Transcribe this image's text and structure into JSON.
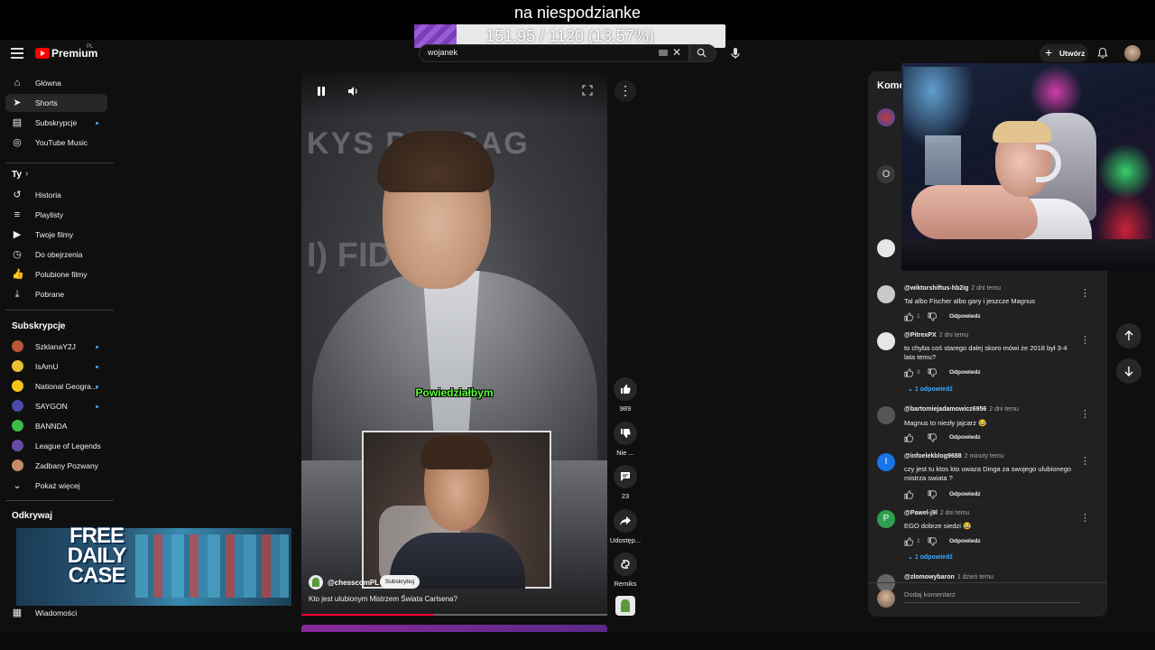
{
  "overlay": {
    "title": "na niespodzianke",
    "progress_text": "151.95 / 1120 (13.57%)",
    "progress_fraction": 0.1357
  },
  "header": {
    "logo_text": "Premium",
    "logo_sup": "PL",
    "search_value": "wojanek",
    "create_label": "Utwórz"
  },
  "sidebar": {
    "main": [
      {
        "label": "Główna",
        "icon": "home-icon"
      },
      {
        "label": "Shorts",
        "icon": "shorts-icon",
        "active": true
      },
      {
        "label": "Subskrypcje",
        "icon": "subscriptions-icon",
        "dot": true
      },
      {
        "label": "YouTube Music",
        "icon": "music-icon"
      }
    ],
    "you_heading": "Ty",
    "you": [
      {
        "label": "Historia",
        "icon": "history-icon"
      },
      {
        "label": "Playlisty",
        "icon": "playlist-icon"
      },
      {
        "label": "Twoje filmy",
        "icon": "your-videos-icon"
      },
      {
        "label": "Do obejrzenia",
        "icon": "watch-later-icon"
      },
      {
        "label": "Polubione filmy",
        "icon": "liked-icon"
      },
      {
        "label": "Pobrane",
        "icon": "download-icon"
      }
    ],
    "subs_heading": "Subskrypcje",
    "subs": [
      {
        "label": "SzklanaY2J",
        "color": "#b8573a"
      },
      {
        "label": "IsAmU",
        "color": "#e8c230"
      },
      {
        "label": "National Geogra...",
        "color": "#f5c518"
      },
      {
        "label": "SAYGON",
        "color": "#4a4aa8"
      },
      {
        "label": "BANNDA",
        "color": "#3dbb4a"
      },
      {
        "label": "League of Legends",
        "color": "#6a4aa8"
      },
      {
        "label": "Zadbany Pozwany",
        "color": "#c48a6a"
      }
    ],
    "show_more": "Pokaż więcej",
    "explore_heading": "Odkrywaj",
    "news": "Wiadomości"
  },
  "ad": {
    "text": "FREE DAILY CASE"
  },
  "video": {
    "backdrop_text": "KYS  PHOSAG",
    "backdrop_text2": "I)  FID    Wor",
    "caption": "Powiedziałbym",
    "channel": "@chesscomPL",
    "subscribe": "Subskrybuj",
    "title": "Kto jest ulubionym Mistrzem Świata Carlsena?",
    "progress_fraction": 0.43,
    "likes": "989",
    "dislike_label": "Nie ...",
    "comments_count": "23",
    "share_label": "Udostęp...",
    "remix_label": "Remiks"
  },
  "comments": {
    "title": "Komentarze",
    "add_placeholder": "Dodaj komentarz",
    "reply_label": "Odpowiedz",
    "items": [
      {
        "author": "@wiktorshiftus-hb2ig",
        "time": "2 dni temu",
        "text": "Tal albo Fischer albo gary i jeszcze Magnus",
        "likes": "1",
        "avatar_color": "#c9c9c9",
        "avatar_letter": ""
      },
      {
        "author": "@PitrexPX",
        "time": "2 dni temu",
        "text": "to chyba coś starego dalej skoro mówi że 2018 był 3-4 lata temu?",
        "likes": "3",
        "avatar_color": "#e6e6e6",
        "avatar_letter": "",
        "replies": "1 odpowiedź"
      },
      {
        "author": "@bartomiejadamowicz6956",
        "time": "2 dni temu",
        "text": "Magnus to niezły jajcarz 😂",
        "likes": "",
        "avatar_color": "#555",
        "avatar_letter": ""
      },
      {
        "author": "@infoelekblog9688",
        "time": "2 minuty temu",
        "text": "czy jest tu ktos kto uwaza Dinga za swojego ulubionego mistrza swiata ?",
        "likes": "",
        "avatar_color": "#1a73e8",
        "avatar_letter": "I"
      },
      {
        "author": "@Pawel-j9l",
        "time": "2 dni temu",
        "text": "EGO dobrze siedzi 😂",
        "likes": "1",
        "avatar_color": "#2e9e4f",
        "avatar_letter": "P",
        "replies": "1 odpowiedź"
      },
      {
        "author": "@zlomowybaron",
        "time": "1 dzień temu",
        "text": "",
        "likes": "",
        "avatar_color": "#666",
        "avatar_letter": ""
      }
    ],
    "partial_avatar_letter": "O"
  }
}
